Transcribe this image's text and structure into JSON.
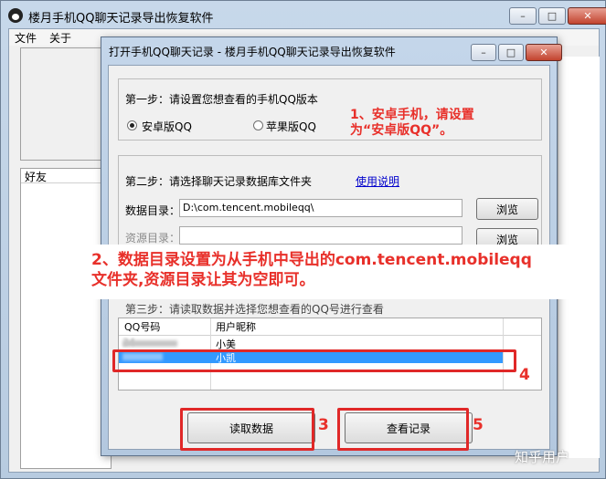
{
  "main_window": {
    "title": "楼月手机QQ聊天记录导出恢复软件",
    "menu": [
      "文件",
      "关于"
    ],
    "friend_list_header": "好友",
    "buttons": {
      "minimize": "–",
      "maximize": "□",
      "close": "✕"
    }
  },
  "dialog": {
    "title": "打开手机QQ聊天记录 - 楼月手机QQ聊天记录导出恢复软件",
    "step1": {
      "label": "第一步：请设置您想查看的手机QQ版本",
      "options": [
        "安卓版QQ",
        "苹果版QQ"
      ],
      "selected": "安卓版QQ"
    },
    "step2": {
      "label": "第二步：请选择聊天记录数据库文件夹",
      "help_link": "使用说明",
      "data_dir_label": "数据目录：",
      "data_dir_value": "D:\\com.tencent.mobileqq\\",
      "res_dir_label": "资源目录：",
      "res_dir_value": "",
      "browse": "浏览"
    },
    "step3": {
      "label": "第三步：请读取数据并选择您想查看的QQ号进行查看",
      "columns": [
        "QQ号码",
        "用户昵称"
      ],
      "rows": [
        {
          "qq": "34",
          "nick": "小美"
        },
        {
          "qq": "",
          "nick": "小凯"
        }
      ]
    },
    "read_button": "读取数据",
    "view_button": "查看记录"
  },
  "annotations": {
    "note1": [
      "1、安卓手机，请设置",
      "为“安卓版QQ”。"
    ],
    "note2": [
      "2、数据目录设置为从手机中导出的com.tencent.mobileqq",
      "文件夹,资源目录让其为空即可。"
    ],
    "num3": "3",
    "num4": "4",
    "num5": "5"
  },
  "watermark": "知乎用户"
}
